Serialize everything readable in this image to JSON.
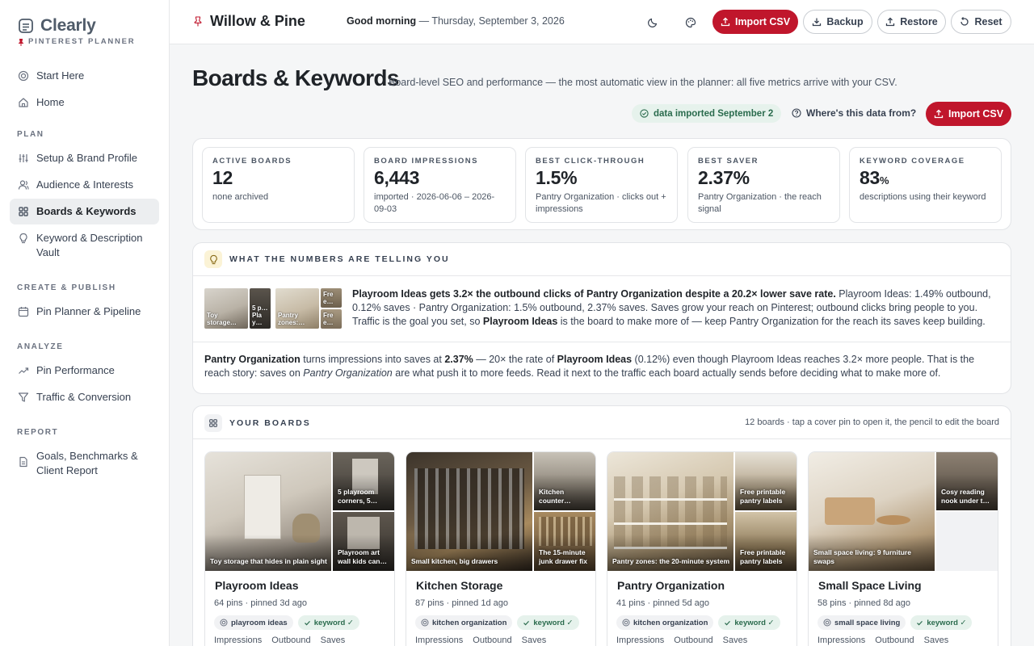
{
  "brand": {
    "name": "Clearly",
    "subtitle": "PINTEREST PLANNER"
  },
  "sidebar": {
    "top": [
      {
        "label": "Start Here",
        "icon": "target-icon"
      },
      {
        "label": "Home",
        "icon": "home-icon"
      }
    ],
    "sections": [
      {
        "title": "PLAN",
        "items": [
          {
            "label": "Setup & Brand Profile",
            "icon": "sliders-icon"
          },
          {
            "label": "Audience & Interests",
            "icon": "user-icon"
          },
          {
            "label": "Boards & Keywords",
            "icon": "grid-icon",
            "active": true
          },
          {
            "label": "Keyword & Description Vault",
            "icon": "lightbulb-icon"
          }
        ]
      },
      {
        "title": "CREATE & PUBLISH",
        "items": [
          {
            "label": "Pin Planner & Pipeline",
            "icon": "calendar-icon"
          }
        ]
      },
      {
        "title": "ANALYZE",
        "items": [
          {
            "label": "Pin Performance",
            "icon": "trend-icon"
          },
          {
            "label": "Traffic & Conversion",
            "icon": "funnel-icon"
          }
        ]
      },
      {
        "title": "REPORT",
        "items": [
          {
            "label": "Goals, Benchmarks & Client Report",
            "icon": "document-icon"
          }
        ]
      }
    ]
  },
  "topbar": {
    "client": "Willow & Pine",
    "greeting_bold": "Good morning",
    "greeting_rest": " — Thursday, September 3, 2026",
    "import_label": "Import CSV",
    "backup_label": "Backup",
    "restore_label": "Restore",
    "reset_label": "Reset"
  },
  "page": {
    "title": "Boards & Keywords",
    "description": "Board-level SEO and performance — the most automatic view in the planner: all five metrics arrive with your CSV.",
    "imported_pill": "data imported September 2",
    "where_link": "Where's this data from?",
    "import_label": "Import CSV"
  },
  "metrics": [
    {
      "label": "ACTIVE BOARDS",
      "value": "12",
      "unit": "",
      "note": "none archived"
    },
    {
      "label": "BOARD IMPRESSIONS",
      "value": "6,443",
      "unit": "",
      "note": "imported · 2026-06-06 – 2026-09-03"
    },
    {
      "label": "BEST CLICK-THROUGH",
      "value": "1.5%",
      "unit": "",
      "note": "Pantry Organization · clicks out + impressions"
    },
    {
      "label": "BEST SAVER",
      "value": "2.37%",
      "unit": "",
      "note": "Pantry Organization · the reach signal"
    },
    {
      "label": "KEYWORD COVERAGE",
      "value": "83",
      "unit": "%",
      "note": "descriptions using their keyword"
    }
  ],
  "insights": {
    "heading": "WHAT THE NUMBERS ARE TELLING YOU",
    "thumbs_a": {
      "big": "Toy storage…",
      "s1": "5 p… Pla y…",
      "s2": ""
    },
    "thumbs_b": {
      "big": "Pantry zones:…",
      "s1": "Fre e…",
      "s2": "Fre e…"
    },
    "first": {
      "bold": "Playroom Ideas gets 3.2× the outbound clicks of Pantry Organization despite a 20.2× lower save rate.",
      "rest1": " Playroom Ideas: 1.49% outbound, 0.12% saves · Pantry Organization: 1.5% outbound, 2.37% saves. Saves grow your reach on Pinterest; outbound clicks bring people to you. Traffic is the goal you set, so ",
      "bold2": "Playroom Ideas",
      "rest2": " is the board to make more of — keep Pantry Organization for the reach its saves keep building."
    },
    "second": {
      "b1": "Pantry Organization",
      "t1": " turns impressions into saves at ",
      "b2": "2.37%",
      "t2": " — 20× the rate of ",
      "b3": "Playroom Ideas",
      "t3": " (0.12%) even though Playroom Ideas reaches 3.2× more people. That is the reach story: saves on ",
      "i1": "Pantry Organization",
      "t4": " are what push it to more feeds. Read it next to the traffic each board actually sends before deciding what to make more of."
    }
  },
  "boards": {
    "heading": "YOUR BOARDS",
    "note": "12 boards · tap a cover pin to open it, the pencil to edit the board",
    "stat_labels": [
      "Impressions",
      "Outbound",
      "Saves"
    ],
    "keyword_chip": "keyword ✓",
    "cards": [
      {
        "title": "Playroom Ideas",
        "meta": "64 pins · pinned 3d ago",
        "keyword": "playroom ideas",
        "cap_big": "Toy storage that hides in plain sight",
        "cap_s1": "5 playroom corners, 5…",
        "cap_s2": "Playroom art wall kids can…"
      },
      {
        "title": "Kitchen Storage",
        "meta": "87 pins · pinned 1d ago",
        "keyword": "kitchen organization",
        "cap_big": "Small kitchen, big drawers",
        "cap_s1": "Kitchen counter…",
        "cap_s2": "The 15-minute junk drawer fix"
      },
      {
        "title": "Pantry Organization",
        "meta": "41 pins · pinned 5d ago",
        "keyword": "kitchen organization",
        "cap_big": "Pantry zones: the 20-minute system",
        "cap_s1": "Free printable pantry labels",
        "cap_s2": "Free printable pantry labels"
      },
      {
        "title": "Small Space Living",
        "meta": "58 pins · pinned 8d ago",
        "keyword": "small space living",
        "cap_big": "Small space living: 9 furniture swaps",
        "cap_s1": "Cosy reading nook under t…",
        "cap_s2": ""
      }
    ]
  },
  "colors": {
    "accent": "#c0162c",
    "success": "#2a6b4d",
    "success_bg": "#e6f2ec"
  }
}
